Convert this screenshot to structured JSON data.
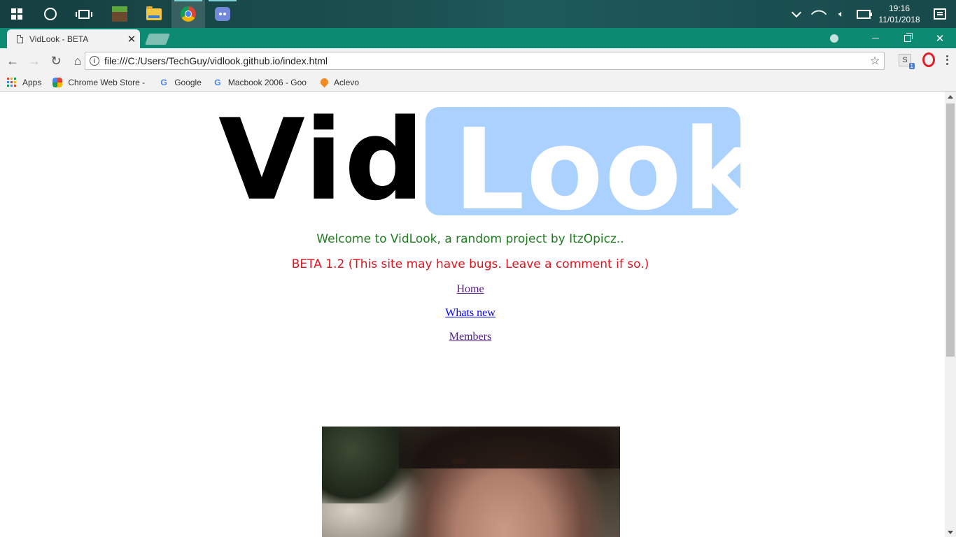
{
  "taskbar": {
    "apps": [
      {
        "name": "start",
        "icon": "windows-logo-icon"
      },
      {
        "name": "cortana",
        "icon": "cortana-icon"
      },
      {
        "name": "task-view",
        "icon": "task-view-icon"
      },
      {
        "name": "minecraft",
        "icon": "minecraft-icon"
      },
      {
        "name": "file-explorer",
        "icon": "folder-icon"
      },
      {
        "name": "chrome",
        "icon": "chrome-icon"
      },
      {
        "name": "discord",
        "icon": "discord-icon"
      }
    ],
    "time": "19:16",
    "date": "11/01/2018"
  },
  "browser": {
    "tab_title": "VidLook - BETA",
    "url": "file:///C:/Users/TechGuy/vidlook.github.io/index.html",
    "accent_color": "#0d8a72",
    "extension_badge": "1",
    "extension_letter": "S",
    "bookmarks": [
      {
        "label": "Apps",
        "icon": "apps-grid-icon"
      },
      {
        "label": "Chrome Web Store -",
        "icon": "chrome-web-store-icon"
      },
      {
        "label": "Google",
        "icon": "google-icon"
      },
      {
        "label": "Macbook 2006 - Goo",
        "icon": "google-icon"
      },
      {
        "label": "Aclevo",
        "icon": "aclevo-icon"
      }
    ]
  },
  "page": {
    "logo_part1": "Vid",
    "logo_part2": "Look",
    "logo_box_color": "#abd1ff",
    "welcome_text": "Welcome to VidLook, a random project by ItzOpicz..",
    "welcome_color": "#1e7d1e",
    "beta_text": "BETA 1.2 (This site may have bugs. Leave a comment if so.)",
    "beta_color": "#e0141e",
    "nav_links": [
      {
        "label": "Home",
        "visited": true
      },
      {
        "label": "Whats new",
        "visited": false
      },
      {
        "label": "Members",
        "visited": true
      }
    ]
  }
}
